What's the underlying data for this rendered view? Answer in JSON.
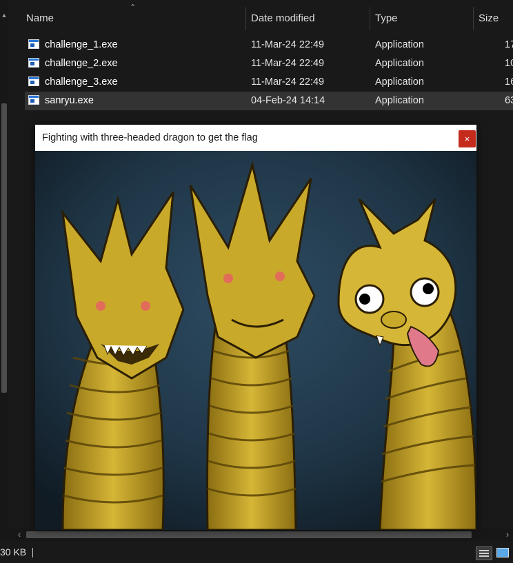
{
  "explorer": {
    "columns": {
      "name": "Name",
      "date": "Date modified",
      "type": "Type",
      "size": "Size"
    },
    "files": [
      {
        "name": "challenge_1.exe",
        "date": "11-Mar-24 22:49",
        "type": "Application",
        "size": "17"
      },
      {
        "name": "challenge_2.exe",
        "date": "11-Mar-24 22:49",
        "type": "Application",
        "size": "10"
      },
      {
        "name": "challenge_3.exe",
        "date": "11-Mar-24 22:49",
        "type": "Application",
        "size": "16"
      },
      {
        "name": "sanryu.exe",
        "date": "04-Feb-24 14:14",
        "type": "Application",
        "size": "63"
      }
    ],
    "status": {
      "selection_size": "30 KB"
    }
  },
  "popup": {
    "title": "Fighting with three-headed dragon to get the flag",
    "close_glyph": "×"
  },
  "colors": {
    "background": "#191919",
    "selected_row": "#333333",
    "close_button": "#c42b1c",
    "dragon_gold": "#c9a92a",
    "sky_dark": "#1f3647"
  }
}
